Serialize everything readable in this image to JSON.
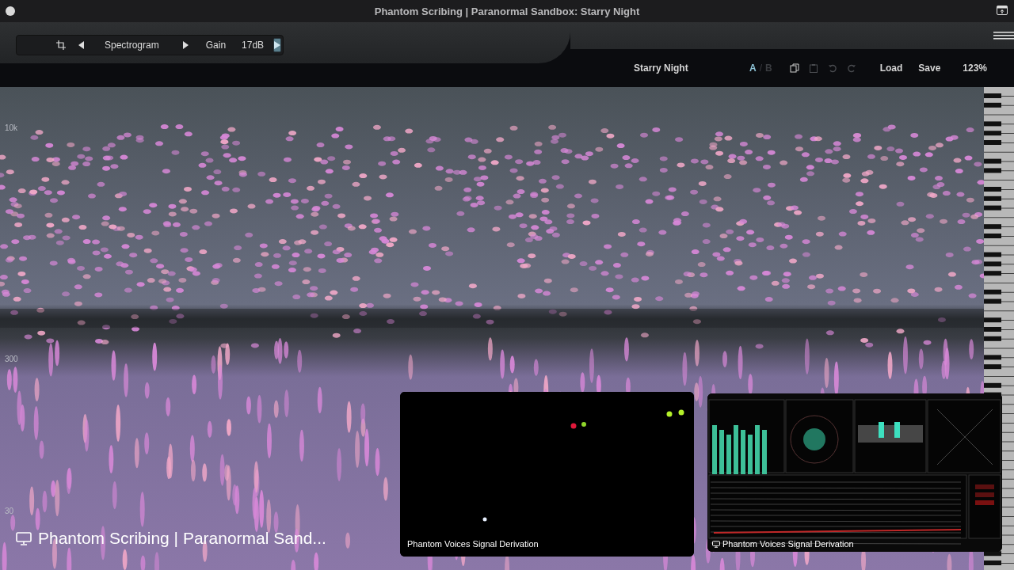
{
  "window": {
    "title": "Phantom Scribing | Paranormal Sandbox: Starry Night"
  },
  "toolbar": {
    "view": "Spectrogram",
    "gain_label": "Gain",
    "gain_value": "17dB",
    "play_active": true
  },
  "preset_bar": {
    "preset_name": "Starry Night",
    "ab_separator": "/",
    "ab_slots": [
      {
        "label": "A",
        "selected": true
      },
      {
        "label": "B",
        "selected": false
      }
    ],
    "icons": [
      {
        "kind": "copy",
        "disabled": false
      },
      {
        "kind": "paste",
        "disabled": true
      },
      {
        "kind": "undo",
        "disabled": true
      },
      {
        "kind": "redo",
        "disabled": true
      }
    ],
    "actions": [
      "Load",
      "Save"
    ],
    "zoom": "123%"
  },
  "spectrogram": {
    "axis_labels": [
      "10k",
      "300",
      "30"
    ]
  },
  "screen_share_caption": "Phantom Scribing | Paranormal Sand...",
  "videos": [
    {
      "kind": "camera",
      "caption": "Phantom Voices Signal Derivation"
    },
    {
      "kind": "screen",
      "caption": "Phantom Voices Signal Derivation"
    }
  ]
}
